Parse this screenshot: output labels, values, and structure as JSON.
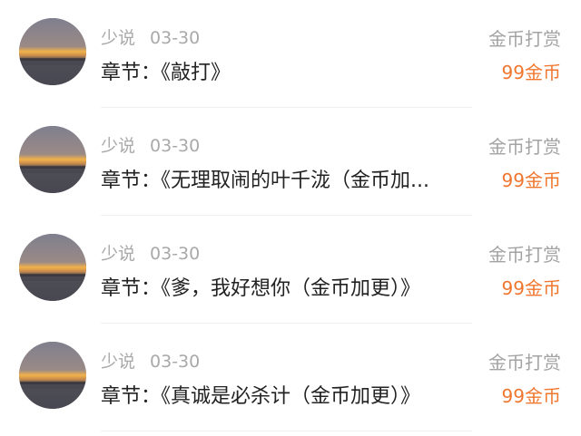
{
  "items": [
    {
      "author": "少说",
      "date": "03-30",
      "chapter_prefix": "章节：",
      "chapter_title": "《敲打》",
      "reward_label": "金币打赏",
      "reward_amount": "99金币"
    },
    {
      "author": "少说",
      "date": "03-30",
      "chapter_prefix": "章节：",
      "chapter_title": "《无理取闹的叶千泷（金币加...",
      "reward_label": "金币打赏",
      "reward_amount": "99金币"
    },
    {
      "author": "少说",
      "date": "03-30",
      "chapter_prefix": "章节：",
      "chapter_title": "《爹，我好想你（金币加更）》",
      "reward_label": "金币打赏",
      "reward_amount": "99金币"
    },
    {
      "author": "少说",
      "date": "03-30",
      "chapter_prefix": "章节：",
      "chapter_title": "《真诚是必杀计（金币加更）》",
      "reward_label": "金币打赏",
      "reward_amount": "99金币"
    }
  ],
  "colors": {
    "meta_text": "#a9a9a9",
    "chapter_text": "#222222",
    "reward_label": "#a3a3a3",
    "reward_amount": "#f0762e",
    "divider": "#efefef"
  },
  "icons": {
    "avatar": "sunset-avatar-image"
  }
}
